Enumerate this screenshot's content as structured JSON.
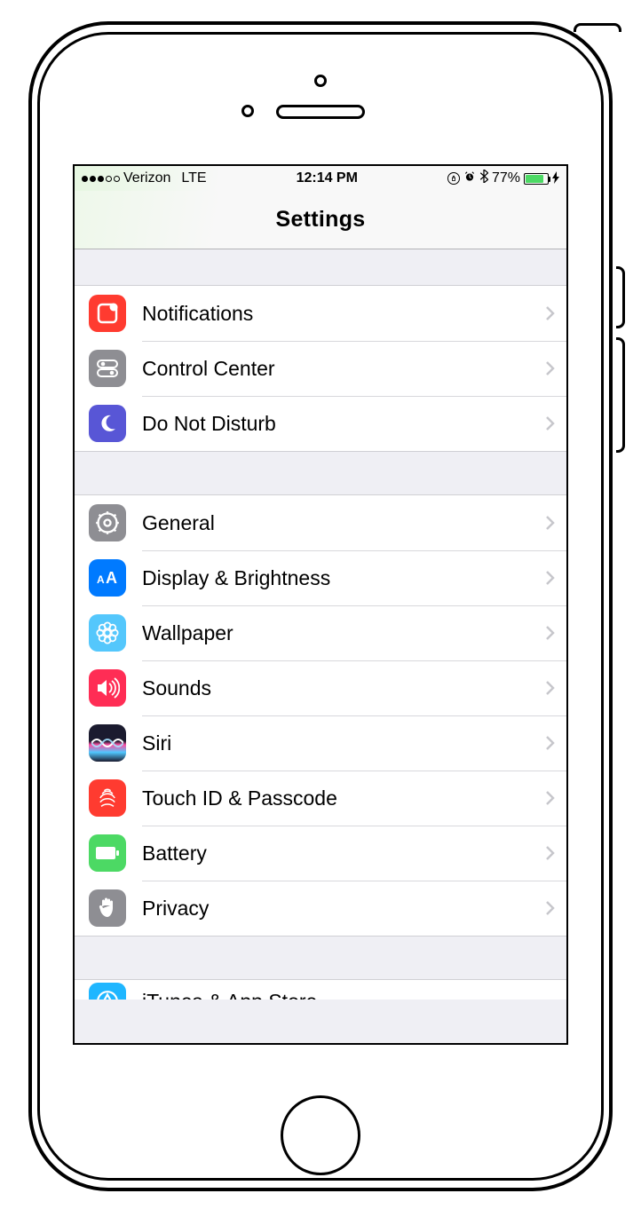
{
  "status": {
    "carrier": "Verizon",
    "network": "LTE",
    "time": "12:14 PM",
    "battery_pct": "77%"
  },
  "header": {
    "title": "Settings"
  },
  "g1": {
    "i0": {
      "label": "Notifications"
    },
    "i1": {
      "label": "Control Center"
    },
    "i2": {
      "label": "Do Not Disturb"
    }
  },
  "g2": {
    "i0": {
      "label": "General"
    },
    "i1": {
      "label": "Display & Brightness"
    },
    "i2": {
      "label": "Wallpaper"
    },
    "i3": {
      "label": "Sounds"
    },
    "i4": {
      "label": "Siri"
    },
    "i5": {
      "label": "Touch ID & Passcode"
    },
    "i6": {
      "label": "Battery"
    },
    "i7": {
      "label": "Privacy"
    }
  },
  "g3": {
    "i0": {
      "label": "iTunes & App Store"
    }
  }
}
